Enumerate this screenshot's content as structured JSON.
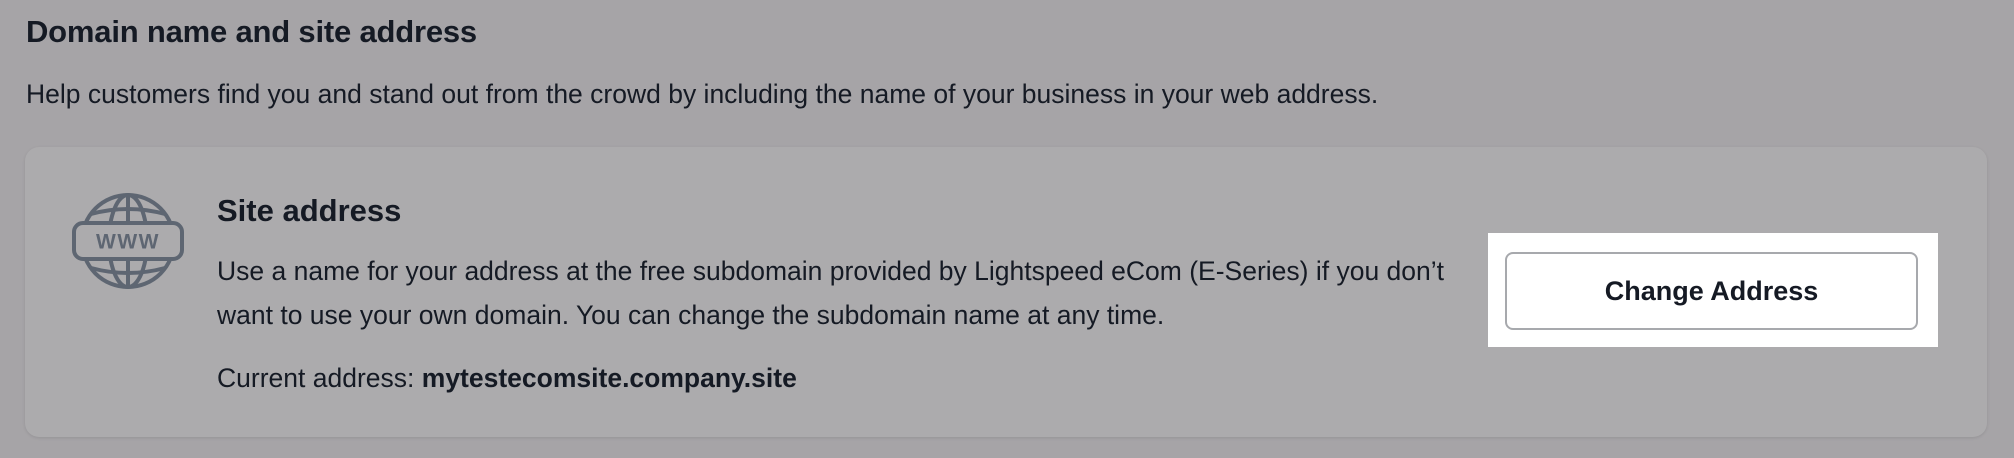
{
  "section": {
    "title": "Domain name and site address",
    "description": "Help customers find you and stand out from the crowd by including the name of your business in your web address."
  },
  "card": {
    "icon": "www-globe-icon",
    "title": "Site address",
    "description": "Use a name for your address at the free subdomain provided by Lightspeed eCom (E-Series) if you don’t want to use your own domain. You can change the subdomain name at any time.",
    "current_label": "Current address:",
    "current_value": "mytestecomsite.company.site",
    "button_label": "Change Address",
    "icon_text": "WWW"
  },
  "colors": {
    "background": "#a6a4a7",
    "card": "#acabad",
    "text": "#151a24",
    "icon": "#5e6672",
    "button_bg": "#ffffff",
    "button_border": "#a7a9ad"
  }
}
